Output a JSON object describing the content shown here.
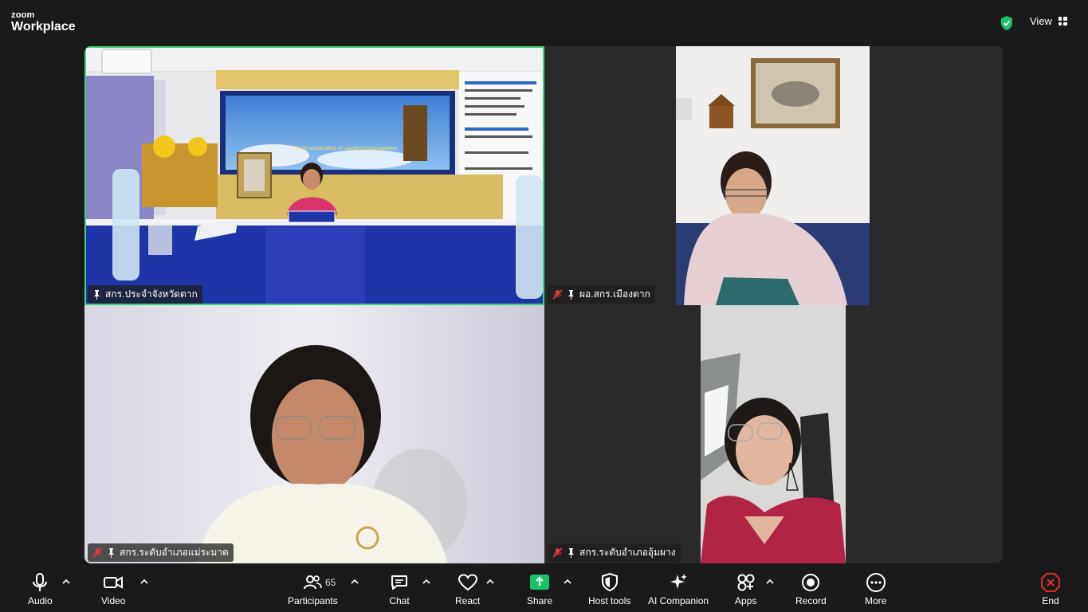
{
  "app": {
    "logo_small": "zoom",
    "logo_big": "Workplace"
  },
  "header": {
    "view_label": "View"
  },
  "tiles": [
    {
      "name": "สกร.ประจำจังหวัดตาก",
      "muted": false,
      "pinned": true,
      "active_speaker": true,
      "scene": {
        "banner_text": "Tak Provincial Office of Learning Encouragement"
      }
    },
    {
      "name": "ผอ.สกร.เมืองตาก",
      "muted": true,
      "pinned": true,
      "active_speaker": false
    },
    {
      "name": "สกร.ระดับอำเภอแม่ระมาด",
      "muted": true,
      "pinned": true,
      "active_speaker": false
    },
    {
      "name": "สกร.ระดับอำเภออุ้มผาง",
      "muted": true,
      "pinned": true,
      "active_speaker": false
    }
  ],
  "toolbar": {
    "audio": "Audio",
    "video": "Video",
    "participants": "Participants",
    "participants_count": "65",
    "chat": "Chat",
    "react": "React",
    "share": "Share",
    "host_tools": "Host tools",
    "ai_companion": "AI Companion",
    "apps": "Apps",
    "record": "Record",
    "more": "More",
    "end": "End"
  },
  "colors": {
    "accent_green": "#3fd47b",
    "share_green": "#19c26b",
    "end_red": "#e02a2a",
    "background": "#1a1a1a"
  }
}
